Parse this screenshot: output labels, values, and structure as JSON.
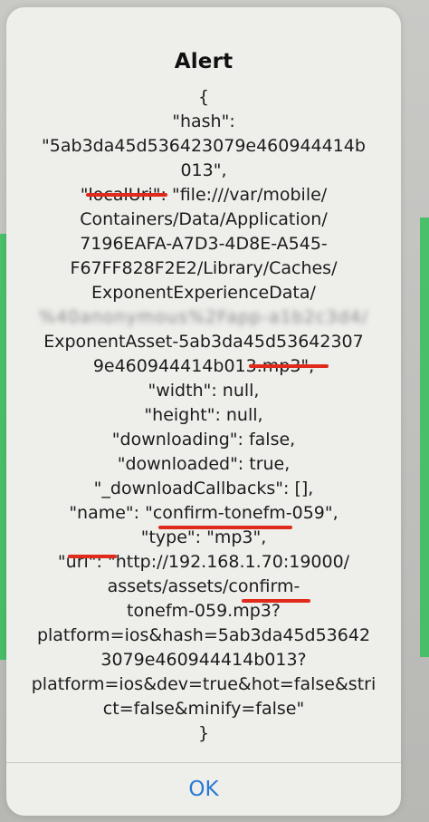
{
  "alert": {
    "title": "Alert",
    "message_lines": [
      "{",
      "\"hash\":",
      "\"5ab3da45d536423079e460944414b",
      "013\",",
      "\"localUri\": \"file:///var/mobile/",
      "Containers/Data/Application/",
      "7196EAFA-A7D3-4D8E-A545-",
      "F67FF828F2E2/Library/Caches/",
      "ExponentExperienceData/",
      "%40anonymous%2Fapp-a1b2c3d4/",
      "ExponentAsset-5ab3da45d53642307",
      "9e460944414b013.mp3\",",
      "\"width\": null,",
      "\"height\": null,",
      "\"downloading\": false,",
      "\"downloaded\": true,",
      "\"_downloadCallbacks\": [],",
      "\"name\": \"confirm-tonefm-059\",",
      "\"type\": \"mp3\",",
      "\"uri\": \"http://192.168.1.70:19000/",
      "assets/assets/confirm-",
      "tonefm-059.mp3?",
      "platform=ios&hash=5ab3da45d53642",
      "3079e460944414b013?",
      "platform=ios&dev=true&hot=false&stri",
      "ct=false&minify=false\"",
      "}"
    ],
    "ok_label": "OK"
  },
  "colors": {
    "accent": "#2a79d6",
    "annotation": "#e02a1b",
    "background_green": "#2bbf52"
  }
}
